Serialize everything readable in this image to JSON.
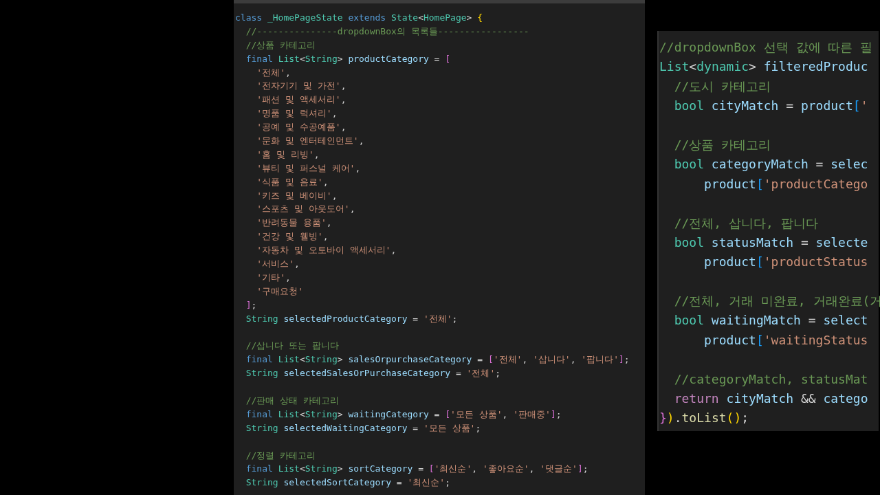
{
  "main_editor": {
    "lines": [
      {
        "kind": "code",
        "tokens": [
          {
            "kind": "k",
            "text": "class "
          },
          {
            "kind": "t",
            "text": "_HomePageState "
          },
          {
            "kind": "k",
            "text": "extends "
          },
          {
            "kind": "t",
            "text": "State"
          },
          {
            "kind": "p",
            "text": "<"
          },
          {
            "kind": "t",
            "text": "HomePage"
          },
          {
            "kind": "p",
            "text": "> "
          },
          {
            "kind": "y",
            "text": "{"
          }
        ]
      },
      {
        "kind": "code",
        "tokens": [
          {
            "kind": "c",
            "text": "  //---------------dropdownBox의 목록들-----------------"
          }
        ]
      },
      {
        "kind": "code",
        "tokens": [
          {
            "kind": "c",
            "text": "  //상품 카테고리"
          }
        ]
      },
      {
        "kind": "code",
        "tokens": [
          {
            "kind": "k",
            "text": "  final "
          },
          {
            "kind": "t",
            "text": "List"
          },
          {
            "kind": "p",
            "text": "<"
          },
          {
            "kind": "t",
            "text": "String"
          },
          {
            "kind": "p",
            "text": "> "
          },
          {
            "kind": "v",
            "text": "productCategory"
          },
          {
            "kind": "p",
            "text": " = "
          },
          {
            "kind": "m",
            "text": "["
          }
        ]
      },
      {
        "kind": "code",
        "tokens": [
          {
            "kind": "s",
            "text": "    '전체'"
          },
          {
            "kind": "p",
            "text": ","
          }
        ]
      },
      {
        "kind": "code",
        "tokens": [
          {
            "kind": "s",
            "text": "    '전자기기 및 가전'"
          },
          {
            "kind": "p",
            "text": ","
          }
        ]
      },
      {
        "kind": "code",
        "tokens": [
          {
            "kind": "s",
            "text": "    '패션 및 액세서리'"
          },
          {
            "kind": "p",
            "text": ","
          }
        ]
      },
      {
        "kind": "code",
        "tokens": [
          {
            "kind": "s",
            "text": "    '명품 및 럭셔리'"
          },
          {
            "kind": "p",
            "text": ","
          }
        ]
      },
      {
        "kind": "code",
        "tokens": [
          {
            "kind": "s",
            "text": "    '공예 및 수공예품'"
          },
          {
            "kind": "p",
            "text": ","
          }
        ]
      },
      {
        "kind": "code",
        "tokens": [
          {
            "kind": "s",
            "text": "    '문화 및 엔터테인먼트'"
          },
          {
            "kind": "p",
            "text": ","
          }
        ]
      },
      {
        "kind": "code",
        "tokens": [
          {
            "kind": "s",
            "text": "    '홈 및 리빙'"
          },
          {
            "kind": "p",
            "text": ","
          }
        ]
      },
      {
        "kind": "code",
        "tokens": [
          {
            "kind": "s",
            "text": "    '뷰티 및 퍼스널 케어'"
          },
          {
            "kind": "p",
            "text": ","
          }
        ]
      },
      {
        "kind": "code",
        "tokens": [
          {
            "kind": "s",
            "text": "    '식품 및 음료'"
          },
          {
            "kind": "p",
            "text": ","
          }
        ]
      },
      {
        "kind": "code",
        "tokens": [
          {
            "kind": "s",
            "text": "    '키즈 및 베이비'"
          },
          {
            "kind": "p",
            "text": ","
          }
        ]
      },
      {
        "kind": "code",
        "tokens": [
          {
            "kind": "s",
            "text": "    '스포츠 및 아웃도어'"
          },
          {
            "kind": "p",
            "text": ","
          }
        ]
      },
      {
        "kind": "code",
        "tokens": [
          {
            "kind": "s",
            "text": "    '반려동물 용품'"
          },
          {
            "kind": "p",
            "text": ","
          }
        ]
      },
      {
        "kind": "code",
        "tokens": [
          {
            "kind": "s",
            "text": "    '건강 및 웰빙'"
          },
          {
            "kind": "p",
            "text": ","
          }
        ]
      },
      {
        "kind": "code",
        "tokens": [
          {
            "kind": "s",
            "text": "    '자동차 및 오토바이 액세서리'"
          },
          {
            "kind": "p",
            "text": ","
          }
        ]
      },
      {
        "kind": "code",
        "tokens": [
          {
            "kind": "s",
            "text": "    '서비스'"
          },
          {
            "kind": "p",
            "text": ","
          }
        ]
      },
      {
        "kind": "code",
        "tokens": [
          {
            "kind": "s",
            "text": "    '기타'"
          },
          {
            "kind": "p",
            "text": ","
          }
        ]
      },
      {
        "kind": "code",
        "tokens": [
          {
            "kind": "s",
            "text": "    '구매요청'"
          }
        ]
      },
      {
        "kind": "code",
        "tokens": [
          {
            "kind": "m",
            "text": "  ]"
          },
          {
            "kind": "p",
            "text": ";"
          }
        ]
      },
      {
        "kind": "code",
        "tokens": [
          {
            "kind": "t",
            "text": "  String "
          },
          {
            "kind": "v",
            "text": "selectedProductCategory"
          },
          {
            "kind": "p",
            "text": " = "
          },
          {
            "kind": "s",
            "text": "'전체'"
          },
          {
            "kind": "p",
            "text": ";"
          }
        ]
      },
      {
        "kind": "blank"
      },
      {
        "kind": "code",
        "tokens": [
          {
            "kind": "c",
            "text": "  //삽니다 또는 팝니다"
          }
        ]
      },
      {
        "kind": "code",
        "tokens": [
          {
            "kind": "k",
            "text": "  final "
          },
          {
            "kind": "t",
            "text": "List"
          },
          {
            "kind": "p",
            "text": "<"
          },
          {
            "kind": "t",
            "text": "String"
          },
          {
            "kind": "p",
            "text": "> "
          },
          {
            "kind": "v",
            "text": "salesOrpurchaseCategory"
          },
          {
            "kind": "p",
            "text": " = "
          },
          {
            "kind": "m",
            "text": "["
          },
          {
            "kind": "s",
            "text": "'전체'"
          },
          {
            "kind": "p",
            "text": ", "
          },
          {
            "kind": "s",
            "text": "'삽니다'"
          },
          {
            "kind": "p",
            "text": ", "
          },
          {
            "kind": "s",
            "text": "'팝니다'"
          },
          {
            "kind": "m",
            "text": "]"
          },
          {
            "kind": "p",
            "text": ";"
          }
        ]
      },
      {
        "kind": "code",
        "tokens": [
          {
            "kind": "t",
            "text": "  String "
          },
          {
            "kind": "v",
            "text": "selectedSalesOrPurchaseCategory"
          },
          {
            "kind": "p",
            "text": " = "
          },
          {
            "kind": "s",
            "text": "'전체'"
          },
          {
            "kind": "p",
            "text": ";"
          }
        ]
      },
      {
        "kind": "blank"
      },
      {
        "kind": "code",
        "tokens": [
          {
            "kind": "c",
            "text": "  //판매 상태 카테고리"
          }
        ]
      },
      {
        "kind": "code",
        "tokens": [
          {
            "kind": "k",
            "text": "  final "
          },
          {
            "kind": "t",
            "text": "List"
          },
          {
            "kind": "p",
            "text": "<"
          },
          {
            "kind": "t",
            "text": "String"
          },
          {
            "kind": "p",
            "text": "> "
          },
          {
            "kind": "v",
            "text": "waitingCategory"
          },
          {
            "kind": "p",
            "text": " = "
          },
          {
            "kind": "m",
            "text": "["
          },
          {
            "kind": "s",
            "text": "'모든 상품'"
          },
          {
            "kind": "p",
            "text": ", "
          },
          {
            "kind": "s",
            "text": "'판매중'"
          },
          {
            "kind": "m",
            "text": "]"
          },
          {
            "kind": "p",
            "text": ";"
          }
        ]
      },
      {
        "kind": "code",
        "tokens": [
          {
            "kind": "t",
            "text": "  String "
          },
          {
            "kind": "v",
            "text": "selectedWaitingCategory"
          },
          {
            "kind": "p",
            "text": " = "
          },
          {
            "kind": "s",
            "text": "'모든 상품'"
          },
          {
            "kind": "p",
            "text": ";"
          }
        ]
      },
      {
        "kind": "blank"
      },
      {
        "kind": "code",
        "tokens": [
          {
            "kind": "c",
            "text": "  //정렬 카테고리"
          }
        ]
      },
      {
        "kind": "code",
        "tokens": [
          {
            "kind": "k",
            "text": "  final "
          },
          {
            "kind": "t",
            "text": "List"
          },
          {
            "kind": "p",
            "text": "<"
          },
          {
            "kind": "t",
            "text": "String"
          },
          {
            "kind": "p",
            "text": "> "
          },
          {
            "kind": "v",
            "text": "sortCategory"
          },
          {
            "kind": "p",
            "text": " = "
          },
          {
            "kind": "m",
            "text": "["
          },
          {
            "kind": "s",
            "text": "'최신순'"
          },
          {
            "kind": "p",
            "text": ", "
          },
          {
            "kind": "s",
            "text": "'좋아요순'"
          },
          {
            "kind": "p",
            "text": ", "
          },
          {
            "kind": "s",
            "text": "'댓글순'"
          },
          {
            "kind": "m",
            "text": "]"
          },
          {
            "kind": "p",
            "text": ";"
          }
        ]
      },
      {
        "kind": "code",
        "tokens": [
          {
            "kind": "t",
            "text": "  String "
          },
          {
            "kind": "v",
            "text": "selectedSortCategory"
          },
          {
            "kind": "p",
            "text": " = "
          },
          {
            "kind": "s",
            "text": "'최신순'"
          },
          {
            "kind": "p",
            "text": ";"
          }
        ]
      }
    ]
  },
  "zoomed_editor": {
    "lines": [
      {
        "kind": "code",
        "tokens": [
          {
            "kind": "c",
            "text": "//dropdownBox 선택 값에 따른 필"
          }
        ]
      },
      {
        "kind": "code",
        "tokens": [
          {
            "kind": "t",
            "text": "List"
          },
          {
            "kind": "p",
            "text": "<"
          },
          {
            "kind": "t",
            "text": "dynamic"
          },
          {
            "kind": "p",
            "text": "> "
          },
          {
            "kind": "v",
            "text": "filteredProduc"
          }
        ]
      },
      {
        "kind": "code",
        "tokens": [
          {
            "kind": "c",
            "text": "  //도시 카테고리"
          }
        ]
      },
      {
        "kind": "code",
        "tokens": [
          {
            "kind": "t",
            "text": "  bool "
          },
          {
            "kind": "v",
            "text": "cityMatch"
          },
          {
            "kind": "p",
            "text": " = "
          },
          {
            "kind": "v",
            "text": "product"
          },
          {
            "kind": "b",
            "text": "["
          },
          {
            "kind": "s",
            "text": "'"
          }
        ]
      },
      {
        "kind": "blank"
      },
      {
        "kind": "code",
        "tokens": [
          {
            "kind": "c",
            "text": "  //상품 카테고리"
          }
        ]
      },
      {
        "kind": "code",
        "tokens": [
          {
            "kind": "t",
            "text": "  bool "
          },
          {
            "kind": "v",
            "text": "categoryMatch"
          },
          {
            "kind": "p",
            "text": " = "
          },
          {
            "kind": "v",
            "text": "selec"
          }
        ]
      },
      {
        "kind": "code",
        "tokens": [
          {
            "kind": "v",
            "text": "      product"
          },
          {
            "kind": "b",
            "text": "["
          },
          {
            "kind": "s",
            "text": "'productCatego"
          }
        ]
      },
      {
        "kind": "blank"
      },
      {
        "kind": "code",
        "tokens": [
          {
            "kind": "c",
            "text": "  //전체, 삽니다, 팝니다"
          }
        ]
      },
      {
        "kind": "code",
        "tokens": [
          {
            "kind": "t",
            "text": "  bool "
          },
          {
            "kind": "v",
            "text": "statusMatch"
          },
          {
            "kind": "p",
            "text": " = "
          },
          {
            "kind": "v",
            "text": "selecte"
          }
        ]
      },
      {
        "kind": "code",
        "tokens": [
          {
            "kind": "v",
            "text": "      product"
          },
          {
            "kind": "b",
            "text": "["
          },
          {
            "kind": "s",
            "text": "'productStatus"
          }
        ]
      },
      {
        "kind": "blank"
      },
      {
        "kind": "code",
        "tokens": [
          {
            "kind": "c",
            "text": "  //전체, 거래 미완료, 거래완료(거"
          }
        ]
      },
      {
        "kind": "code",
        "tokens": [
          {
            "kind": "t",
            "text": "  bool "
          },
          {
            "kind": "v",
            "text": "waitingMatch"
          },
          {
            "kind": "p",
            "text": " = "
          },
          {
            "kind": "v",
            "text": "select"
          }
        ]
      },
      {
        "kind": "code",
        "tokens": [
          {
            "kind": "v",
            "text": "      product"
          },
          {
            "kind": "b",
            "text": "["
          },
          {
            "kind": "s",
            "text": "'waitingStatus"
          }
        ]
      },
      {
        "kind": "blank"
      },
      {
        "kind": "code",
        "tokens": [
          {
            "kind": "c",
            "text": "  //categoryMatch, statusMat"
          }
        ]
      },
      {
        "kind": "code",
        "tokens": [
          {
            "kind": "r",
            "text": "  return "
          },
          {
            "kind": "v",
            "text": "cityMatch"
          },
          {
            "kind": "p",
            "text": " && "
          },
          {
            "kind": "v",
            "text": "catego"
          }
        ]
      },
      {
        "kind": "code",
        "tokens": [
          {
            "kind": "m",
            "text": "}"
          },
          {
            "kind": "y",
            "text": ")"
          },
          {
            "kind": "p",
            "text": "."
          },
          {
            "kind": "f",
            "text": "toList"
          },
          {
            "kind": "y",
            "text": "()"
          },
          {
            "kind": "p",
            "text": ";"
          }
        ]
      }
    ]
  }
}
